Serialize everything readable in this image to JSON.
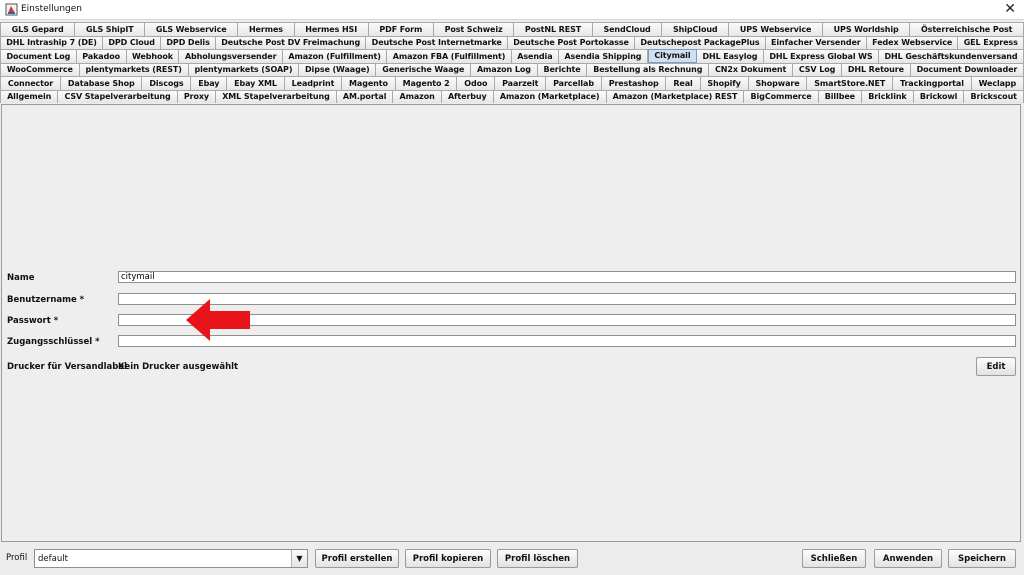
{
  "window": {
    "title": "Einstellungen",
    "close": "✕"
  },
  "tabs": {
    "rows": [
      [
        "GLS Gepard",
        "GLS ShipIT",
        "GLS Webservice",
        "Hermes",
        "Hermes HSI",
        "PDF Form",
        "Post Schweiz",
        "PostNL REST",
        "SendCloud",
        "ShipCloud",
        "UPS Webservice",
        "UPS Worldship",
        "Österreichische Post"
      ],
      [
        "DHL Intraship 7 (DE)",
        "DPD Cloud",
        "DPD Delis",
        "Deutsche Post DV Freimachung",
        "Deutsche Post Internetmarke",
        "Deutsche Post Portokasse",
        "Deutschepost PackagePlus",
        "Einfacher Versender",
        "Fedex Webservice",
        "GEL Express"
      ],
      [
        "Document Log",
        "Pakadoo",
        "Webhook",
        "Abholungsversender",
        "Amazon (Fulfillment)",
        "Amazon FBA (Fulfillment)",
        "Asendia",
        "Asendia Shipping",
        "Citymail",
        "DHL Easylog",
        "DHL Express Global WS",
        "DHL Geschäftskundenversand"
      ],
      [
        "WooCommerce",
        "plentymarkets (REST)",
        "plentymarkets (SOAP)",
        "Dipse (Waage)",
        "Generische Waage",
        "Amazon Log",
        "Berichte",
        "Bestellung als Rechnung",
        "CN2x Dokument",
        "CSV Log",
        "DHL Retoure",
        "Document Downloader"
      ],
      [
        "Connector",
        "Database Shop",
        "Discogs",
        "Ebay",
        "Ebay XML",
        "Leadprint",
        "Magento",
        "Magento 2",
        "Odoo",
        "Paarzeit",
        "Parcellab",
        "Prestashop",
        "Real",
        "Shopify",
        "Shopware",
        "SmartStore.NET",
        "Trackingportal",
        "Weclapp"
      ],
      [
        "Allgemein",
        "CSV Stapelverarbeitung",
        "Proxy",
        "XML Stapelverarbeitung",
        "AM.portal",
        "Amazon",
        "Afterbuy",
        "Amazon (Marketplace)",
        "Amazon (Marketplace) REST",
        "BigCommerce",
        "Billbee",
        "Bricklink",
        "Brickowl",
        "Brickscout"
      ]
    ],
    "selected": "Citymail"
  },
  "form": {
    "name_label": "Name",
    "name_value": "citymail",
    "username_label": "Benutzername *",
    "username_value": "",
    "password_label": "Passwort *",
    "password_value": "",
    "key_label": "Zugangsschlüssel *",
    "key_value": "",
    "printer_label": "Drucker für Versandlabel",
    "printer_value": "Kein Drucker ausgewählt",
    "edit_label": "Edit"
  },
  "bottom": {
    "profil_label": "Profil",
    "profil_value": "default",
    "create_label": "Profil erstellen",
    "copy_label": "Profil kopieren",
    "delete_label": "Profil löschen",
    "close_label": "Schließen",
    "apply_label": "Anwenden",
    "save_label": "Speichern"
  },
  "colors": {
    "arrow": "#e8141b",
    "selected_tab": "#cfe0f3"
  }
}
